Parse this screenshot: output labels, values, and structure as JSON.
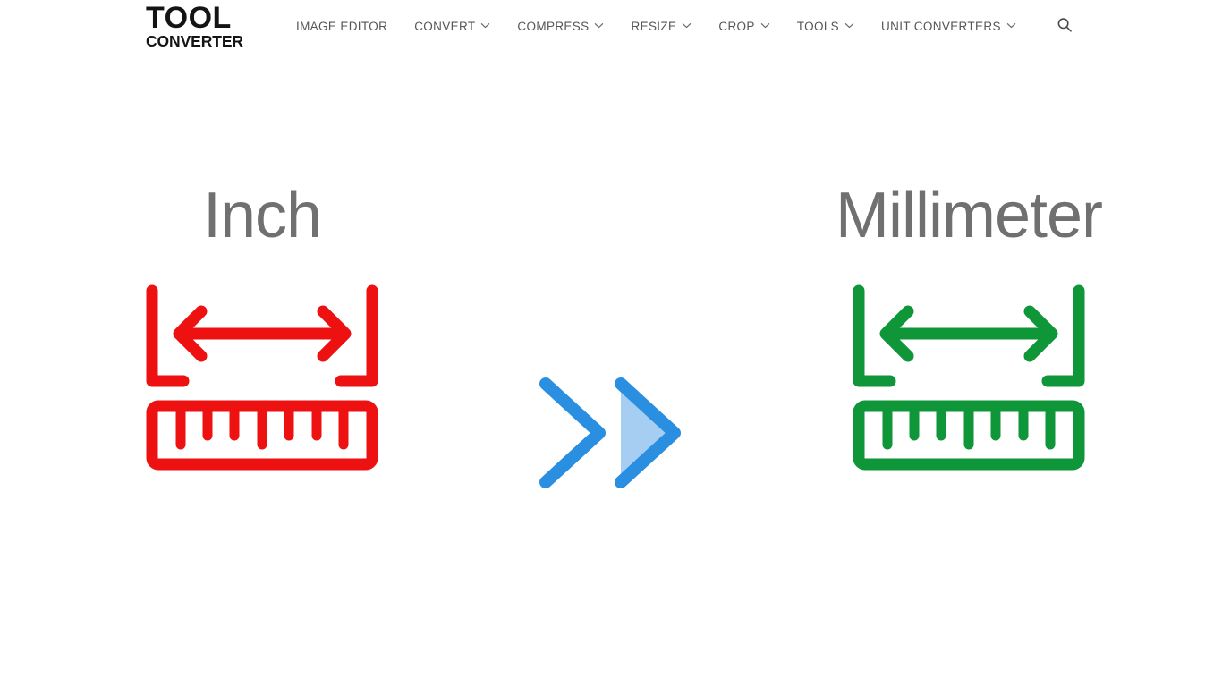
{
  "header": {
    "brand": {
      "line1": "TOOL",
      "line2": "CONVERTER",
      "name": "Tool Converter"
    },
    "nav_items": [
      {
        "label": "IMAGE EDITOR",
        "has_dropdown": false
      },
      {
        "label": "CONVERT",
        "has_dropdown": true
      },
      {
        "label": "COMPRESS",
        "has_dropdown": true
      },
      {
        "label": "RESIZE",
        "has_dropdown": true
      },
      {
        "label": "CROP",
        "has_dropdown": true
      },
      {
        "label": "TOOLS",
        "has_dropdown": true
      },
      {
        "label": "UNIT CONVERTERS",
        "has_dropdown": true
      }
    ],
    "search": {
      "icon": "search-icon",
      "label": "Search"
    }
  },
  "hero": {
    "source_unit": {
      "title": "Inch",
      "icon": "ruler-measure-icon",
      "color": "#EE1111"
    },
    "conversion_arrow": {
      "icon": "double-chevron-right-icon",
      "stroke_color": "#2A8FE0",
      "fill_color": "#A6CEF2"
    },
    "target_unit": {
      "title": "Millimeter",
      "icon": "ruler-measure-icon",
      "color": "#0E9638"
    }
  },
  "theme": {
    "background": "#FFFFFF",
    "title_color": "#707070",
    "nav_color": "#565656",
    "brand_color": "#141414"
  }
}
